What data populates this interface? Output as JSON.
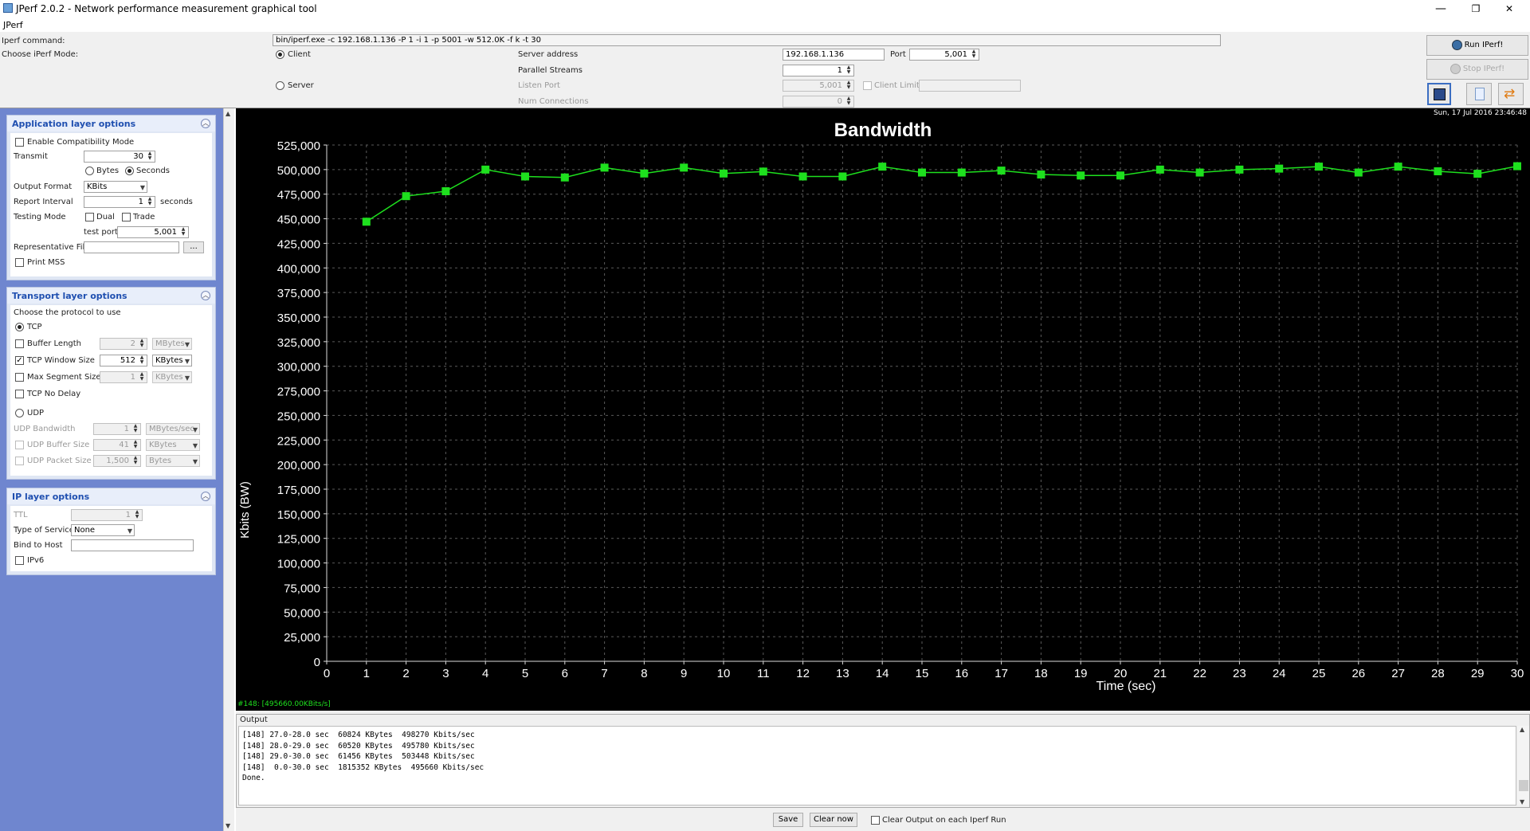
{
  "window": {
    "title": "JPerf 2.0.2 - Network performance measurement graphical tool",
    "minimize": "—",
    "restore": "❐",
    "close": "✕"
  },
  "menu": {
    "app": "JPerf"
  },
  "top": {
    "iperf_command_label": "Iperf command:",
    "iperf_command": "bin/iperf.exe -c 192.168.1.136 -P 1 -i 1 -p 5001 -w 512.0K -f k -t 30",
    "mode_label": "Choose iPerf Mode:",
    "client_label": "Client",
    "server_label": "Server",
    "server_address_label": "Server address",
    "server_address": "192.168.1.136",
    "port_label": "Port",
    "port": "5,001",
    "parallel_label": "Parallel Streams",
    "parallel": "1",
    "listen_port_label": "Listen Port",
    "listen_port": "5,001",
    "client_limit_label": "Client Limit",
    "num_conn_label": "Num Connections",
    "num_conn": "0",
    "run_label": "Run IPerf!",
    "stop_label": "Stop IPerf!"
  },
  "app_layer": {
    "title": "Application layer options",
    "compat_label": "Enable Compatibility Mode",
    "transmit_label": "Transmit",
    "transmit": "30",
    "bytes_label": "Bytes",
    "seconds_label": "Seconds",
    "output_format_label": "Output Format",
    "output_format": "KBits",
    "report_interval_label": "Report Interval",
    "report_interval": "1",
    "seconds_unit": "seconds",
    "testing_mode_label": "Testing Mode",
    "dual_label": "Dual",
    "trade_label": "Trade",
    "test_port_label": "test port",
    "test_port": "5,001",
    "rep_file_label": "Representative File",
    "browse": "...",
    "print_mss_label": "Print MSS"
  },
  "transport": {
    "title": "Transport layer options",
    "choose_label": "Choose the protocol to use",
    "tcp_label": "TCP",
    "buffer_length_label": "Buffer Length",
    "buffer_length": "2",
    "buffer_unit": "MBytes",
    "tcp_window_label": "TCP Window Size",
    "tcp_window": "512",
    "tcp_window_unit": "KBytes",
    "max_seg_label": "Max Segment Size",
    "max_seg": "1",
    "max_seg_unit": "KBytes",
    "nodelay_label": "TCP No Delay",
    "udp_label": "UDP",
    "udp_bw_label": "UDP Bandwidth",
    "udp_bw": "1",
    "udp_bw_unit": "MBytes/sec",
    "udp_buf_label": "UDP Buffer Size",
    "udp_buf": "41",
    "udp_buf_unit": "KBytes",
    "udp_pkt_label": "UDP Packet Size",
    "udp_pkt": "1,500",
    "udp_pkt_unit": "Bytes"
  },
  "ip_layer": {
    "title": "IP layer options",
    "ttl_label": "TTL",
    "ttl": "1",
    "tos_label": "Type of Service",
    "tos": "None",
    "bind_label": "Bind to Host",
    "ipv6_label": "IPv6"
  },
  "graph": {
    "timestamp": "Sun, 17 Jul 2016 23:46:48",
    "legend": "#148: [495660.00KBits/s]",
    "colors": {
      "background": "#000000",
      "line": "#1ee01e",
      "grid": "#5a5a5a",
      "text": "#ffffff"
    }
  },
  "chart_data": {
    "type": "line",
    "title": "Bandwidth",
    "xlabel": "Time (sec)",
    "ylabel": "Kbits (BW)",
    "xlim": [
      0,
      30
    ],
    "ylim": [
      0,
      525000
    ],
    "x_ticks": [
      0,
      1,
      2,
      3,
      4,
      5,
      6,
      7,
      8,
      9,
      10,
      11,
      12,
      13,
      14,
      15,
      16,
      17,
      18,
      19,
      20,
      21,
      22,
      23,
      24,
      25,
      26,
      27,
      28,
      29,
      30
    ],
    "y_ticks": [
      0,
      25000,
      50000,
      75000,
      100000,
      125000,
      150000,
      175000,
      200000,
      225000,
      250000,
      275000,
      300000,
      325000,
      350000,
      375000,
      400000,
      425000,
      450000,
      475000,
      500000,
      525000
    ],
    "y_tick_labels": [
      "0",
      "25,000",
      "50,000",
      "75,000",
      "100,000",
      "125,000",
      "150,000",
      "175,000",
      "200,000",
      "225,000",
      "250,000",
      "275,000",
      "300,000",
      "325,000",
      "350,000",
      "375,000",
      "400,000",
      "425,000",
      "450,000",
      "475,000",
      "500,000",
      "525,000"
    ],
    "grid": true,
    "series": [
      {
        "x": [
          1,
          2,
          3,
          4,
          5,
          6,
          7,
          8,
          9,
          10,
          11,
          12,
          13,
          14,
          15,
          16,
          17,
          18,
          19,
          20,
          21,
          22,
          23,
          24,
          25,
          26,
          27,
          28,
          29,
          30
        ],
        "values": [
          447000,
          473000,
          478000,
          500000,
          493000,
          492000,
          502000,
          496000,
          502000,
          496000,
          498000,
          493000,
          493000,
          503000,
          497000,
          497000,
          499000,
          495000,
          494000,
          494000,
          500000,
          497000,
          500000,
          501000,
          503000,
          497000,
          503000,
          498270,
          495780,
          503448
        ]
      }
    ]
  },
  "output": {
    "tab_label": "Output",
    "lines": [
      "[148] 27.0-28.0 sec  60824 KBytes  498270 Kbits/sec",
      "[148] 28.0-29.0 sec  60520 KBytes  495780 Kbits/sec",
      "[148] 29.0-30.0 sec  61456 KBytes  503448 Kbits/sec",
      "[148]  0.0-30.0 sec  1815352 KBytes  495660 Kbits/sec",
      "Done."
    ],
    "save_label": "Save",
    "clear_label": "Clear now",
    "clear_each_label": "Clear Output on each Iperf Run"
  }
}
